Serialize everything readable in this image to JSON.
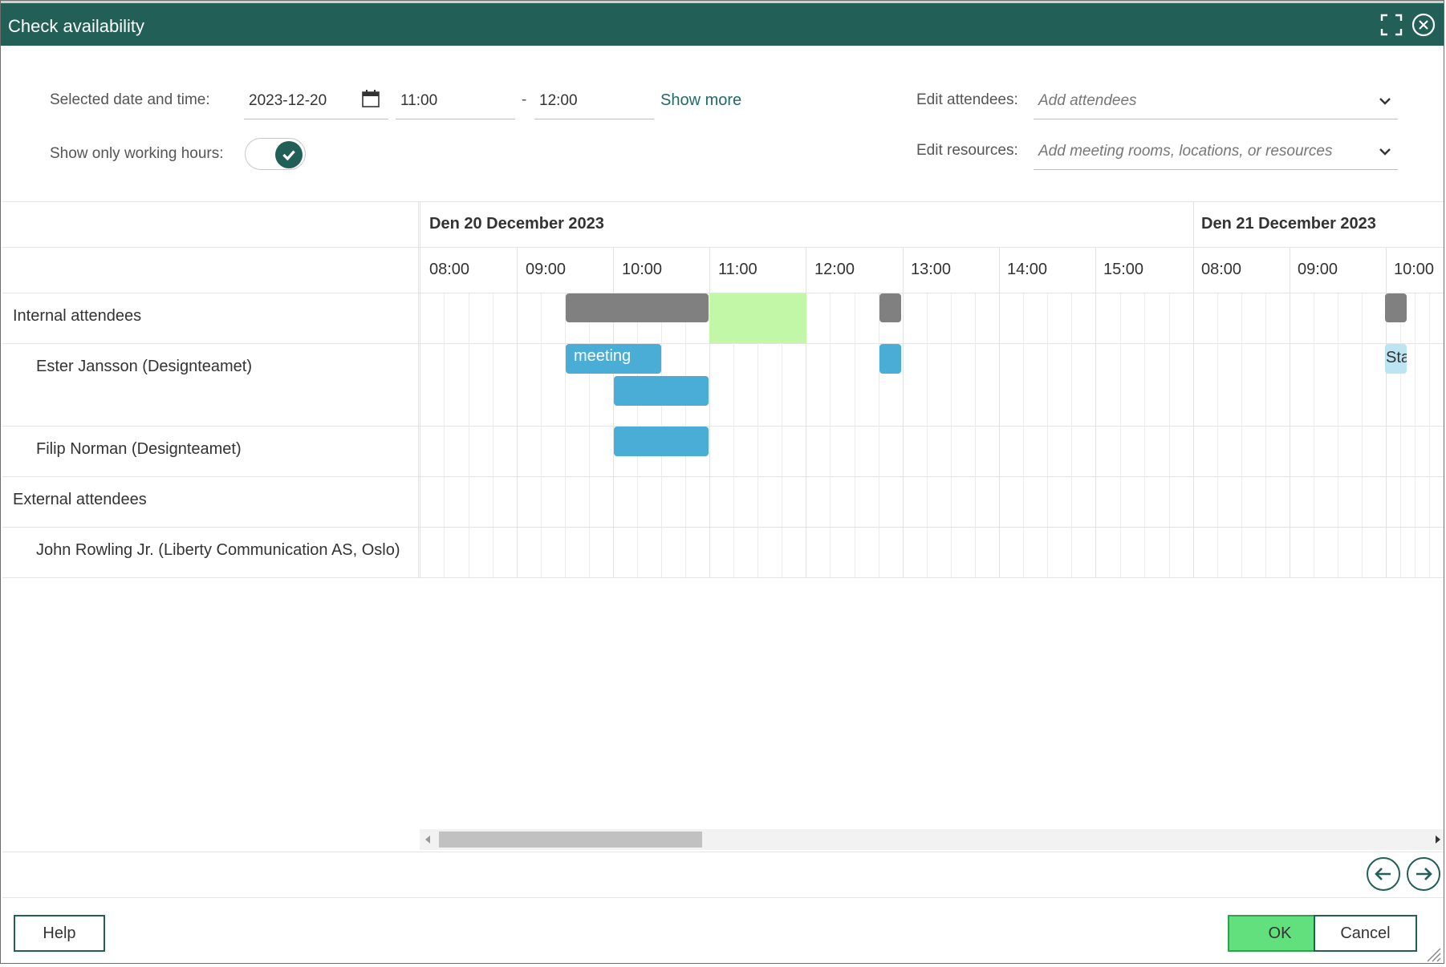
{
  "window": {
    "title": "Check availability"
  },
  "form": {
    "selected_label": "Selected date and time:",
    "date": "2023-12-20",
    "start_time": "11:00",
    "dash": "-",
    "end_time": "12:00",
    "show_more": "Show more",
    "working_hours_label": "Show only working hours:",
    "working_hours_on": true,
    "attendees_label": "Edit attendees:",
    "attendees_placeholder": "Add attendees",
    "resources_label": "Edit resources:",
    "resources_placeholder": "Add meeting rooms, locations, or resources"
  },
  "schedule": {
    "days": [
      "Den 20 December 2023",
      "Den 21 December 2023"
    ],
    "hours_day1": [
      "08:00",
      "09:00",
      "10:00",
      "11:00",
      "12:00",
      "13:00",
      "14:00",
      "15:00"
    ],
    "hours_day2": [
      "08:00",
      "09:00",
      "10:00"
    ],
    "rows": {
      "internal": "Internal attendees",
      "ester": "Ester Jansson (Designteamet)",
      "filip": "Filip Norman (Designteamet)",
      "external": "External attendees",
      "john": "John Rowling Jr. (Liberty Communication AS, Oslo)"
    },
    "events": {
      "ester_meeting": "meeting",
      "ester_next_day": "Sta"
    }
  },
  "footer": {
    "help": "Help",
    "ok": "OK",
    "cancel": "Cancel"
  },
  "colors": {
    "titlebar": "#215f57",
    "busy": "#808080",
    "event": "#4aadd6",
    "selection": "#c1f7a6",
    "ok_button": "#62e07e"
  }
}
